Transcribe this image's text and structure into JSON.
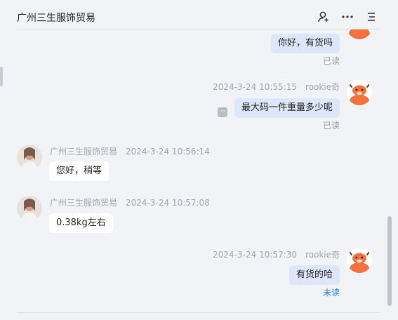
{
  "header": {
    "title": "广州三生服饰贸易",
    "icons": [
      "add-person-icon",
      "more-horizontal-icon",
      "menu-list-icon"
    ]
  },
  "messages": [
    {
      "side": "me",
      "text": "你好，有货吗",
      "status": "已读"
    },
    {
      "side": "me",
      "sender": "rookie奇",
      "time": "2024-3-24 10:55:15",
      "text": "最大码一件重量多少呢",
      "status": "已读"
    },
    {
      "side": "them",
      "sender": "广州三生服饰贸易",
      "time": "2024-3-24 10:56:14",
      "text": "您好，稍等"
    },
    {
      "side": "them",
      "sender": "广州三生服饰贸易",
      "time": "2024-3-24 10:57:08",
      "text": "0.38kg左右"
    },
    {
      "side": "me",
      "sender": "rookie奇",
      "time": "2024-3-24 10:57:30",
      "text": "有货的哈",
      "status": "未读"
    }
  ],
  "colors": {
    "background": "#f2f3f7",
    "my_bubble": "#dde6fb",
    "their_bubble": "#ffffff",
    "read_status": "#9a9a9a",
    "unread_status": "#2a7fdc",
    "avatar_orange": "#f2733f"
  }
}
